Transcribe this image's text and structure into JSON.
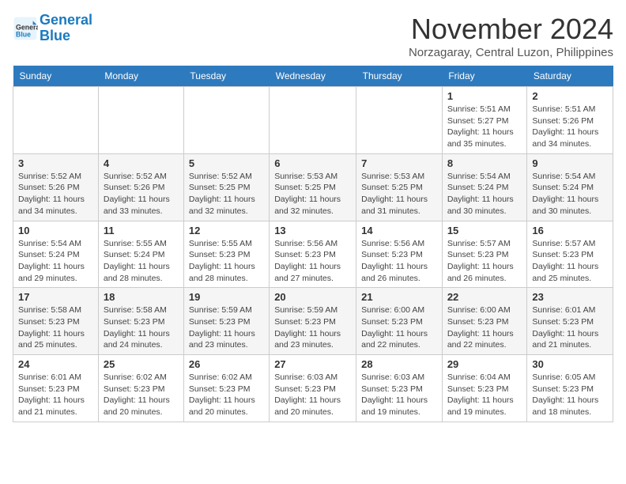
{
  "header": {
    "logo_line1": "General",
    "logo_line2": "Blue",
    "month": "November 2024",
    "location": "Norzagaray, Central Luzon, Philippines"
  },
  "weekdays": [
    "Sunday",
    "Monday",
    "Tuesday",
    "Wednesday",
    "Thursday",
    "Friday",
    "Saturday"
  ],
  "weeks": [
    [
      {
        "day": "",
        "info": ""
      },
      {
        "day": "",
        "info": ""
      },
      {
        "day": "",
        "info": ""
      },
      {
        "day": "",
        "info": ""
      },
      {
        "day": "",
        "info": ""
      },
      {
        "day": "1",
        "info": "Sunrise: 5:51 AM\nSunset: 5:27 PM\nDaylight: 11 hours\nand 35 minutes."
      },
      {
        "day": "2",
        "info": "Sunrise: 5:51 AM\nSunset: 5:26 PM\nDaylight: 11 hours\nand 34 minutes."
      }
    ],
    [
      {
        "day": "3",
        "info": "Sunrise: 5:52 AM\nSunset: 5:26 PM\nDaylight: 11 hours\nand 34 minutes."
      },
      {
        "day": "4",
        "info": "Sunrise: 5:52 AM\nSunset: 5:26 PM\nDaylight: 11 hours\nand 33 minutes."
      },
      {
        "day": "5",
        "info": "Sunrise: 5:52 AM\nSunset: 5:25 PM\nDaylight: 11 hours\nand 32 minutes."
      },
      {
        "day": "6",
        "info": "Sunrise: 5:53 AM\nSunset: 5:25 PM\nDaylight: 11 hours\nand 32 minutes."
      },
      {
        "day": "7",
        "info": "Sunrise: 5:53 AM\nSunset: 5:25 PM\nDaylight: 11 hours\nand 31 minutes."
      },
      {
        "day": "8",
        "info": "Sunrise: 5:54 AM\nSunset: 5:24 PM\nDaylight: 11 hours\nand 30 minutes."
      },
      {
        "day": "9",
        "info": "Sunrise: 5:54 AM\nSunset: 5:24 PM\nDaylight: 11 hours\nand 30 minutes."
      }
    ],
    [
      {
        "day": "10",
        "info": "Sunrise: 5:54 AM\nSunset: 5:24 PM\nDaylight: 11 hours\nand 29 minutes."
      },
      {
        "day": "11",
        "info": "Sunrise: 5:55 AM\nSunset: 5:24 PM\nDaylight: 11 hours\nand 28 minutes."
      },
      {
        "day": "12",
        "info": "Sunrise: 5:55 AM\nSunset: 5:23 PM\nDaylight: 11 hours\nand 28 minutes."
      },
      {
        "day": "13",
        "info": "Sunrise: 5:56 AM\nSunset: 5:23 PM\nDaylight: 11 hours\nand 27 minutes."
      },
      {
        "day": "14",
        "info": "Sunrise: 5:56 AM\nSunset: 5:23 PM\nDaylight: 11 hours\nand 26 minutes."
      },
      {
        "day": "15",
        "info": "Sunrise: 5:57 AM\nSunset: 5:23 PM\nDaylight: 11 hours\nand 26 minutes."
      },
      {
        "day": "16",
        "info": "Sunrise: 5:57 AM\nSunset: 5:23 PM\nDaylight: 11 hours\nand 25 minutes."
      }
    ],
    [
      {
        "day": "17",
        "info": "Sunrise: 5:58 AM\nSunset: 5:23 PM\nDaylight: 11 hours\nand 25 minutes."
      },
      {
        "day": "18",
        "info": "Sunrise: 5:58 AM\nSunset: 5:23 PM\nDaylight: 11 hours\nand 24 minutes."
      },
      {
        "day": "19",
        "info": "Sunrise: 5:59 AM\nSunset: 5:23 PM\nDaylight: 11 hours\nand 23 minutes."
      },
      {
        "day": "20",
        "info": "Sunrise: 5:59 AM\nSunset: 5:23 PM\nDaylight: 11 hours\nand 23 minutes."
      },
      {
        "day": "21",
        "info": "Sunrise: 6:00 AM\nSunset: 5:23 PM\nDaylight: 11 hours\nand 22 minutes."
      },
      {
        "day": "22",
        "info": "Sunrise: 6:00 AM\nSunset: 5:23 PM\nDaylight: 11 hours\nand 22 minutes."
      },
      {
        "day": "23",
        "info": "Sunrise: 6:01 AM\nSunset: 5:23 PM\nDaylight: 11 hours\nand 21 minutes."
      }
    ],
    [
      {
        "day": "24",
        "info": "Sunrise: 6:01 AM\nSunset: 5:23 PM\nDaylight: 11 hours\nand 21 minutes."
      },
      {
        "day": "25",
        "info": "Sunrise: 6:02 AM\nSunset: 5:23 PM\nDaylight: 11 hours\nand 20 minutes."
      },
      {
        "day": "26",
        "info": "Sunrise: 6:02 AM\nSunset: 5:23 PM\nDaylight: 11 hours\nand 20 minutes."
      },
      {
        "day": "27",
        "info": "Sunrise: 6:03 AM\nSunset: 5:23 PM\nDaylight: 11 hours\nand 20 minutes."
      },
      {
        "day": "28",
        "info": "Sunrise: 6:03 AM\nSunset: 5:23 PM\nDaylight: 11 hours\nand 19 minutes."
      },
      {
        "day": "29",
        "info": "Sunrise: 6:04 AM\nSunset: 5:23 PM\nDaylight: 11 hours\nand 19 minutes."
      },
      {
        "day": "30",
        "info": "Sunrise: 6:05 AM\nSunset: 5:23 PM\nDaylight: 11 hours\nand 18 minutes."
      }
    ]
  ]
}
